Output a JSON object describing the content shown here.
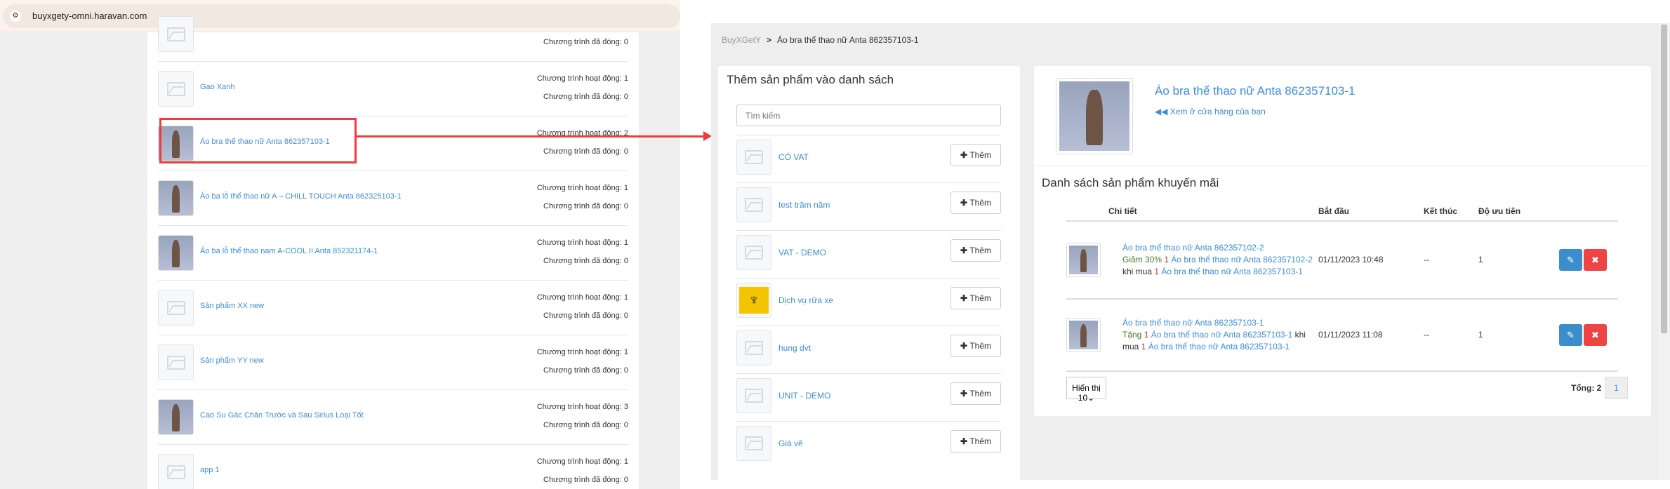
{
  "browser": {
    "url": "buyxgety-omni.haravan.com"
  },
  "left_list": {
    "items": [
      {
        "name": "",
        "active": "",
        "closed": "Chương trình đã đóng: 0",
        "thumb": "placeholder"
      },
      {
        "name": "Gao Xanh",
        "active": "Chương trình hoạt động: 1",
        "closed": "Chương trình đã đóng: 0",
        "thumb": "placeholder"
      },
      {
        "name": "Áo bra thể thao nữ Anta 862357103-1",
        "active": "Chương trình hoạt động: 2",
        "closed": "Chương trình đã đóng: 0",
        "thumb": "photo"
      },
      {
        "name": "Áo ba lỗ thể thao nữ A – CHILL TOUCH Anta 862325103-1",
        "active": "Chương trình hoạt động: 1",
        "closed": "Chương trình đã đóng: 0",
        "thumb": "photo"
      },
      {
        "name": "Áo ba lỗ thể thao nam A-COOL II Anta 852321174-1",
        "active": "Chương trình hoạt động: 1",
        "closed": "Chương trình đã đóng: 0",
        "thumb": "photo"
      },
      {
        "name": "Sản phẩm XX new",
        "active": "Chương trình hoạt động: 1",
        "closed": "Chương trình đã đóng: 0",
        "thumb": "placeholder"
      },
      {
        "name": "Sản phẩm YY new",
        "active": "Chương trình hoạt động: 1",
        "closed": "Chương trình đã đóng: 0",
        "thumb": "placeholder"
      },
      {
        "name": "Cao Su Gác Chân Trước và Sau Sirius Loại Tốt",
        "active": "Chương trình hoạt động: 3",
        "closed": "Chương trình đã đóng: 0",
        "thumb": "photo"
      },
      {
        "name": "app 1",
        "active": "Chương trình hoạt động: 1",
        "closed": "Chương trình đã đóng: 0",
        "thumb": "placeholder"
      }
    ]
  },
  "breadcrumb": {
    "root": "BuyXGetY",
    "separator": ">",
    "current": "Áo bra thể thao nữ Anta 862357103-1"
  },
  "add_panel": {
    "title": "Thêm sản phẩm vào danh sách",
    "search_placeholder": "Tìm kiếm",
    "add_label": "Thêm",
    "items": [
      "CÓ VAT",
      "test trăm năm",
      "VAT - DEMO",
      "Dịch vụ rửa xe",
      "hung dvt",
      "UNIT - DEMO",
      "Giá vẽ"
    ]
  },
  "product": {
    "title": "Áo bra thể thao nữ Anta 862357103-1",
    "view_link": "Xem ở cửa hàng của bạn"
  },
  "promo_list": {
    "title": "Danh sách sản phẩm khuyến mãi",
    "columns": [
      "Chi tiết",
      "Bắt đầu",
      "Kết thúc",
      "Độ ưu tiên"
    ],
    "rows": [
      {
        "product": "Áo bra thể thao nữ Anta 862357102-2",
        "action": "Giảm 30%",
        "qty1": "1",
        "target": "Áo bra thể thao nữ Anta 862357102-2",
        "when": "khi mua",
        "qty2": "1",
        "buy": "Áo bra thể thao nữ Anta 862357103-1",
        "start": "01/11/2023 10:48",
        "end": "--",
        "priority": "1"
      },
      {
        "product": "Áo bra thể thao nữ Anta 862357103-1",
        "action": "Tặng",
        "qty1": "1",
        "target": "Áo bra thể thao nữ Anta 862357103-1",
        "when": "khi mua",
        "qty2": "1",
        "buy": "Áo bra thể thao nữ Anta 862357103-1",
        "start": "01/11/2023 11:08",
        "end": "--",
        "priority": "1"
      }
    ],
    "page_size": "Hiển thị 10",
    "total": "Tổng: 2",
    "page": "1"
  },
  "colors": {
    "link": "#3c8dde",
    "highlight": "#ee3b3b",
    "edit": "#3c8dcc",
    "delete": "#ee4444"
  }
}
